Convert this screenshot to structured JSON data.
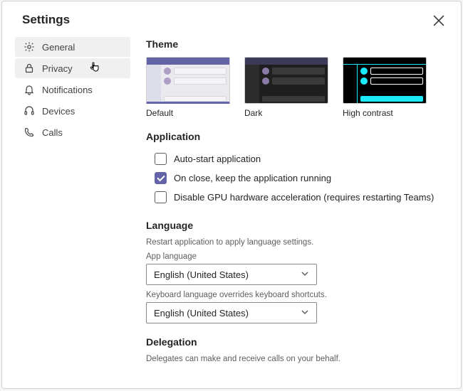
{
  "title": "Settings",
  "nav": {
    "general": "General",
    "privacy": "Privacy",
    "notifications": "Notifications",
    "devices": "Devices",
    "calls": "Calls"
  },
  "theme": {
    "heading": "Theme",
    "default": "Default",
    "dark": "Dark",
    "high_contrast": "High contrast"
  },
  "application": {
    "heading": "Application",
    "auto_start": "Auto-start application",
    "on_close": "On close, keep the application running",
    "disable_gpu": "Disable GPU hardware acceleration (requires restarting Teams)"
  },
  "language": {
    "heading": "Language",
    "hint": "Restart application to apply language settings.",
    "app_label": "App language",
    "app_value": "English (United States)",
    "kb_label": "Keyboard language overrides keyboard shortcuts.",
    "kb_value": "English (United States)"
  },
  "delegation": {
    "heading": "Delegation",
    "hint": "Delegates can make and receive calls on your behalf."
  }
}
